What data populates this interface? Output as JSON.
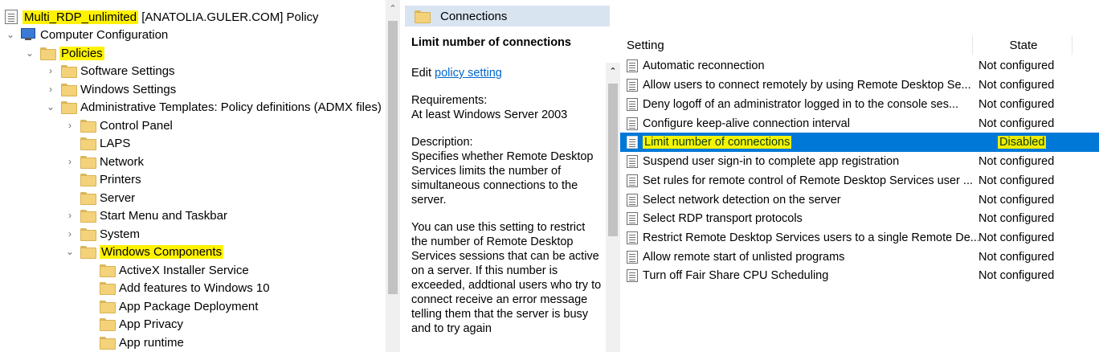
{
  "tree": {
    "root": {
      "name": "Multi_RDP_unlimited",
      "suffix": " [ANATOLIA.GULER.COM] Policy"
    },
    "computer_config": "Computer Configuration",
    "policies": "Policies",
    "software_settings": "Software Settings",
    "windows_settings": "Windows Settings",
    "admin_templates": "Administrative Templates: Policy definitions (ADMX files) re",
    "control_panel": "Control Panel",
    "laps": "LAPS",
    "network": "Network",
    "printers": "Printers",
    "server": "Server",
    "start_menu": "Start Menu and Taskbar",
    "system": "System",
    "windows_components": "Windows Components",
    "activex": "ActiveX Installer Service",
    "add_features": "Add features to Windows 10",
    "app_package": "App Package Deployment",
    "app_privacy": "App Privacy",
    "app_runtime": "App runtime"
  },
  "header": {
    "title": "Connections"
  },
  "description": {
    "title": "Limit number of connections",
    "edit_prefix": "Edit ",
    "edit_link": "policy setting ",
    "requirements_label": "Requirements:",
    "requirements_value": "At least Windows Server 2003",
    "description_label": "Description:",
    "description_text": "Specifies whether Remote Desktop Services limits the number of simultaneous connections to the server.",
    "extra_text": "You can use this setting to restrict the number of Remote Desktop Services sessions that can be active on a server. If this number is exceeded, addtional users who try to connect receive an error message telling them that the server is busy and to try again"
  },
  "list": {
    "col_setting": "Setting",
    "col_state": "State",
    "rows": [
      {
        "name": "Automatic reconnection",
        "state": "Not configured"
      },
      {
        "name": "Allow users to connect remotely by using Remote Desktop Se...",
        "state": "Not configured"
      },
      {
        "name": "Deny logoff of an administrator logged in to the console ses...",
        "state": "Not configured"
      },
      {
        "name": "Configure keep-alive connection interval",
        "state": "Not configured"
      },
      {
        "name": "Limit number of connections",
        "state": "Disabled"
      },
      {
        "name": "Suspend user sign-in to complete app registration",
        "state": "Not configured"
      },
      {
        "name": "Set rules for remote control of Remote Desktop Services user ...",
        "state": "Not configured"
      },
      {
        "name": "Select network detection on the server",
        "state": "Not configured"
      },
      {
        "name": "Select RDP transport protocols",
        "state": "Not configured"
      },
      {
        "name": "Restrict Remote Desktop Services users to a single Remote De...",
        "state": "Not configured"
      },
      {
        "name": "Allow remote start of unlisted programs",
        "state": "Not configured"
      },
      {
        "name": "Turn off Fair Share CPU Scheduling",
        "state": "Not configured"
      }
    ]
  },
  "icons": {
    "tree_chevron_collapsed": "chevron-right-icon",
    "tree_chevron_expanded": "chevron-down-icon",
    "folder": "folder-icon",
    "policy": "policy-icon",
    "computer": "computer-icon"
  }
}
